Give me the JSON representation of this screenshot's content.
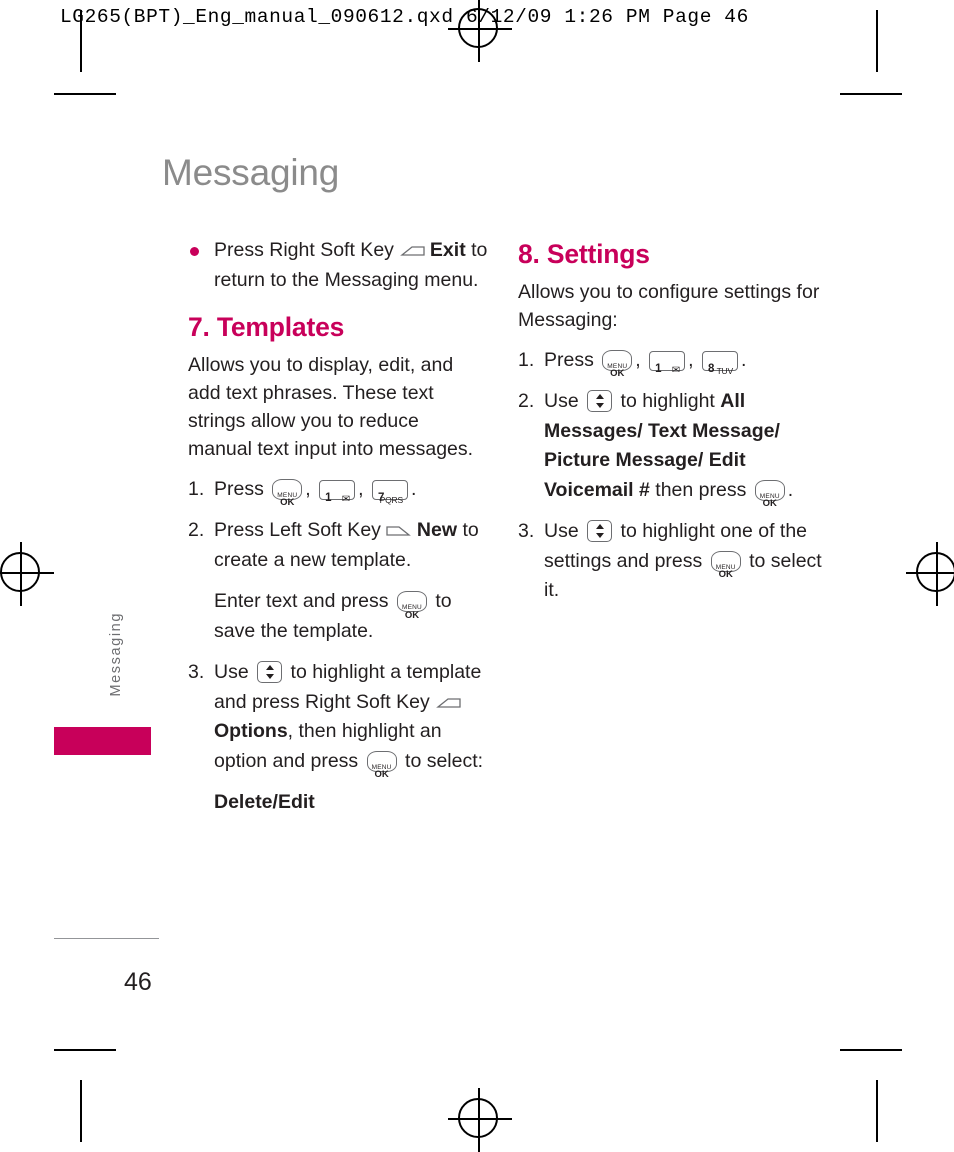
{
  "print_header": "LG265(BPT)_Eng_manual_090612.qxd  6/12/09  1:26 PM  Page 46",
  "chapter": {
    "title": "Messaging",
    "side_tab": "Messaging",
    "page_number": "46"
  },
  "left_column": {
    "bullet": {
      "before_key": "Press Right Soft Key",
      "key": "right-soft-key",
      "bold": "Exit",
      "after": "to return to the Messaging menu."
    },
    "section": {
      "heading": "7. Templates",
      "intro": "Allows you to display, edit, and add text phrases. These text strings allow you to reduce manual text input into messages.",
      "steps": [
        {
          "num": "1.",
          "text_before": "Press",
          "keys": [
            "menu-ok",
            "1-envelope",
            "7-pqrs"
          ],
          "text_after": "."
        },
        {
          "num": "2.",
          "text_before": "Press Left Soft Key",
          "key": "left-soft-key",
          "bold": "New",
          "text_after": "to create a new template.",
          "continuation_before": "Enter text and press",
          "continuation_key": "menu-ok",
          "continuation_after": "to save the template."
        },
        {
          "num": "3.",
          "text_before": "Use",
          "key_nav": "nav-up-down",
          "text_mid": "to highlight a template and press Right Soft Key",
          "key_soft": "right-soft-key",
          "bold": "Options",
          "text_after": ", then highlight an option and press",
          "key_end": "menu-ok",
          "text_end": "to select:",
          "option_bold": "Delete/Edit"
        }
      ]
    }
  },
  "right_column": {
    "section": {
      "heading": "8. Settings",
      "intro": "Allows you to configure settings for Messaging:",
      "steps": [
        {
          "num": "1.",
          "text_before": "Press",
          "keys": [
            "menu-ok",
            "1-envelope",
            "8-tuv"
          ],
          "text_after": "."
        },
        {
          "num": "2.",
          "text_before": "Use",
          "key_nav": "nav-up-down",
          "text_mid": "to highlight",
          "bold": "All Messages/ Text Message/ Picture Message/ Edit Voicemail #",
          "text_after": "then press",
          "key_end": "menu-ok",
          "text_end": "."
        },
        {
          "num": "3.",
          "text_before": "Use",
          "key_nav": "nav-up-down",
          "text_mid": "to highlight one of the settings and press",
          "key_end": "menu-ok",
          "text_end": "to select it."
        }
      ]
    }
  },
  "keys": {
    "menu_ok": {
      "line1": "MENU",
      "line2": "OK"
    },
    "one": {
      "digit": "1",
      "sub": "✉"
    },
    "seven": {
      "digit": "7",
      "sub": "PQRS"
    },
    "eight": {
      "digit": "8",
      "sub": "TUV"
    }
  },
  "colors": {
    "accent": "#c8005a",
    "chapter_gray": "#8b8b8b",
    "body": "#231f20"
  }
}
